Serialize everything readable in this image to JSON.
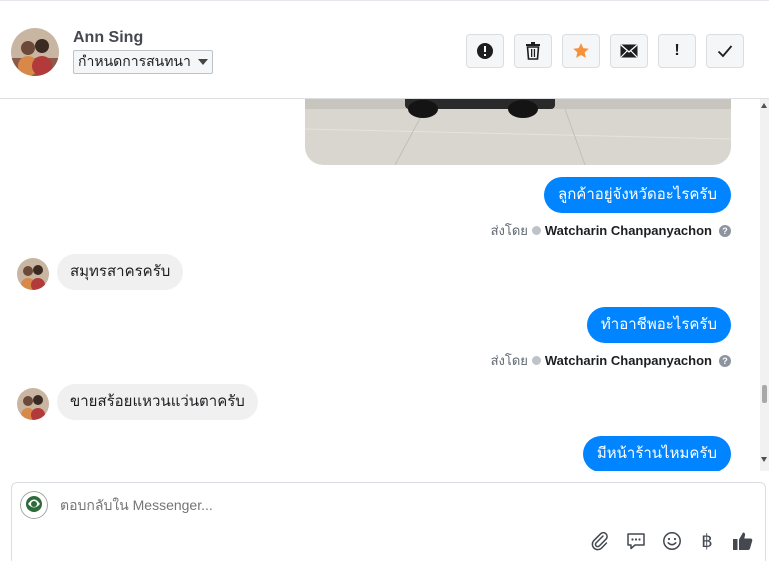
{
  "header": {
    "contact_name": "Ann Sing",
    "conversation_setting": "กำหนดการสนทนา",
    "toolbar": [
      {
        "name": "spam-button",
        "icon": "alert-circle-icon"
      },
      {
        "name": "delete-button",
        "icon": "trash-icon"
      },
      {
        "name": "star-button",
        "icon": "star-icon",
        "color": "#f7923b"
      },
      {
        "name": "mark-unread-button",
        "icon": "envelope-icon"
      },
      {
        "name": "important-button",
        "icon": "exclamation-icon",
        "label": "!"
      },
      {
        "name": "done-button",
        "icon": "checkmark-icon"
      }
    ]
  },
  "messages": {
    "out_1": "ลูกค้าอยู่จังหวัดอะไรครับ",
    "in_1": "สมุทรสาครครับ",
    "out_2": "ทำอาชีพอะไรครับ",
    "in_2": "ขายสร้อยแหวนแว่นตาครับ",
    "out_3": "มีหน้าร้านไหมครับ"
  },
  "sent_by": {
    "label": "ส่งโดย",
    "sender": "Watcharin Chanpanyachon",
    "help": "?"
  },
  "composer": {
    "placeholder": "ตอบกลับใน Messenger...",
    "tools": [
      "attachment-icon",
      "saved-reply-icon",
      "emoji-icon",
      "baht-icon",
      "thumbs-up-icon"
    ],
    "baht_symbol": "฿"
  },
  "colors": {
    "accent": "#0084ff",
    "incoming_bubble": "#f1f0f0",
    "star": "#f7923b"
  }
}
